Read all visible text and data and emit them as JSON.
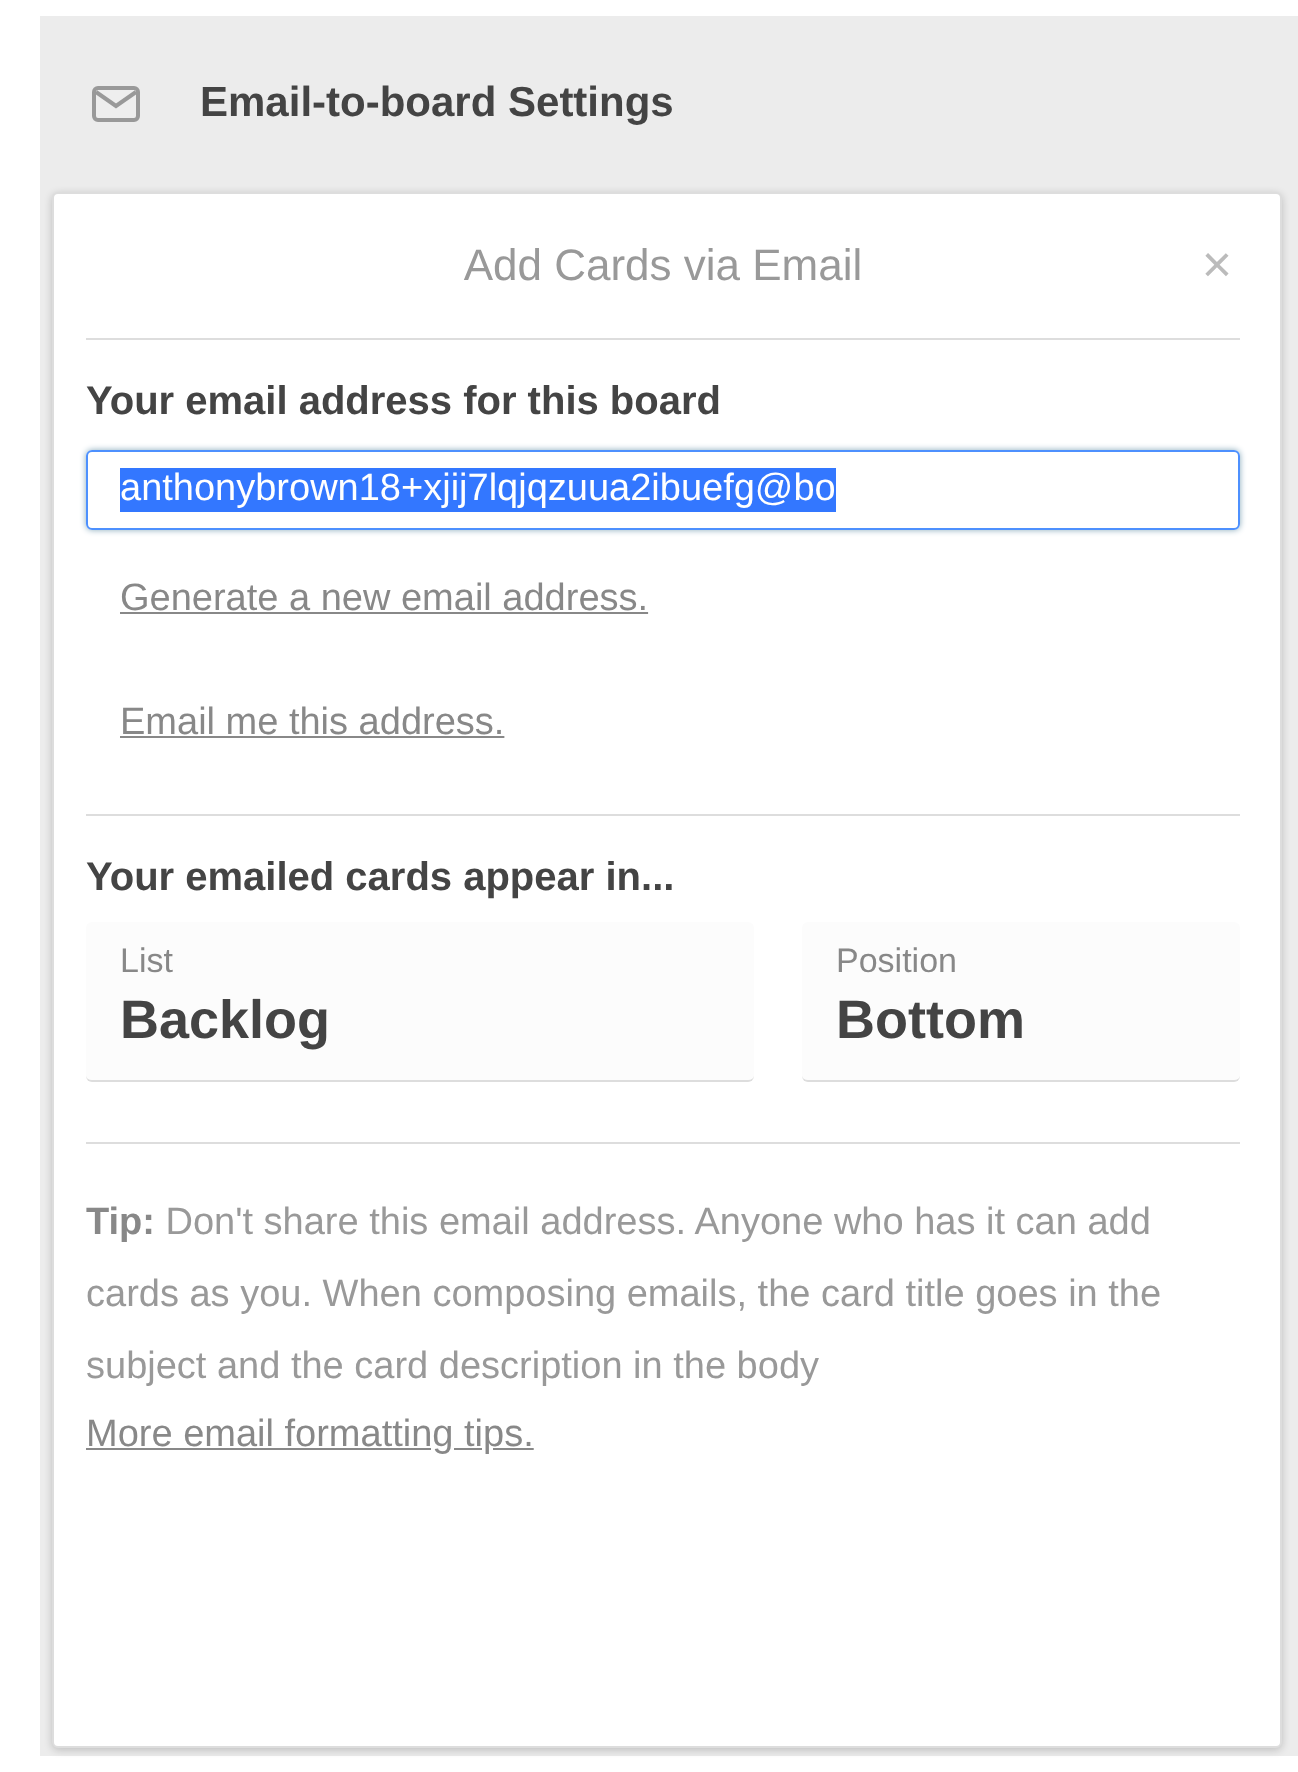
{
  "header": {
    "title": "Email-to-board Settings"
  },
  "popover": {
    "title": "Add Cards via Email",
    "close": "×"
  },
  "address": {
    "label": "Your email address for this board",
    "value": "anthonybrown18+xjij7lqjqzuua2ibuefg@bo",
    "selected": true
  },
  "links": [
    "Generate a new email address.",
    "Email me this address."
  ],
  "destination": {
    "label": "Your emailed cards appear in...",
    "selects": [
      {
        "label": "List",
        "value": "Backlog"
      },
      {
        "label": "Position",
        "value": "Bottom"
      }
    ]
  },
  "tip": {
    "text": "**Tip:** Don't share this email address. Anyone who has it can add cards as you. When composing emails, the card title goes in the subject and the card description in the body",
    "link": "More email formatting tips."
  }
}
